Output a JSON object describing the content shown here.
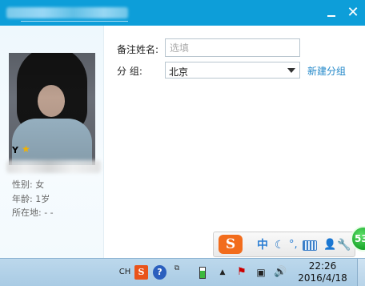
{
  "window": {
    "title_blurred": true,
    "minimize_label": "—",
    "close_label": "✕"
  },
  "profile": {
    "nickname": "Y",
    "star_icon": "★",
    "gender": "性别: 女",
    "age": "年龄: 1岁",
    "location": "所在地:  -    -"
  },
  "form": {
    "remark_label": "备注姓名:",
    "remark_placeholder": "选填",
    "remark_value": "",
    "group_label": "分    组:",
    "group_value": "北京",
    "new_group_link": "新建分组"
  },
  "ime": {
    "logo": "S",
    "mode": "中",
    "moon": "☾",
    "punct": "°,",
    "user": "👤",
    "wrench": "🔧",
    "badge": "53"
  },
  "taskbar": {
    "lang": "CH",
    "sogou": "S",
    "help": "?",
    "restore": "⧉",
    "arrow": "▲",
    "flag": "⚑",
    "net": "▣",
    "volume": "🔊",
    "time": "22:26",
    "date": "2016/4/18"
  },
  "colors": {
    "title_bar": "#0d9ed9",
    "link": "#1f86c8",
    "sogou_orange": "#f26c1c"
  }
}
